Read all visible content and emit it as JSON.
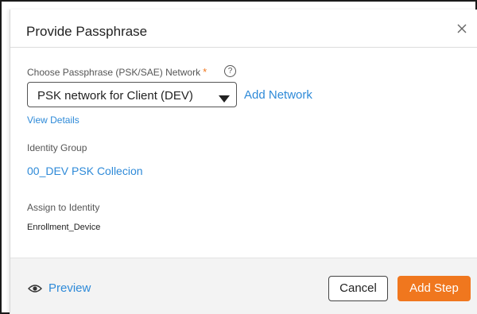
{
  "dialog": {
    "title": "Provide Passphrase",
    "close_icon": "close-icon"
  },
  "network": {
    "label": "Choose Passphrase (PSK/SAE) Network",
    "required_marker": "*",
    "help_icon": "question-circle-icon",
    "help_glyph": "?",
    "selected": "PSK network for Client (DEV)",
    "caret_icon": "caret-down-icon",
    "add_link": "Add Network",
    "details_link": "View Details"
  },
  "identity_group": {
    "label": "Identity Group",
    "value": "00_DEV PSK Collecion"
  },
  "assign_identity": {
    "label": "Assign to Identity",
    "value": "Enrollment_Device"
  },
  "footer": {
    "preview_icon": "eye-icon",
    "preview_label": "Preview",
    "cancel_label": "Cancel",
    "primary_label": "Add Step"
  },
  "colors": {
    "accent": "#f0771e",
    "link": "#2e8ad8"
  }
}
